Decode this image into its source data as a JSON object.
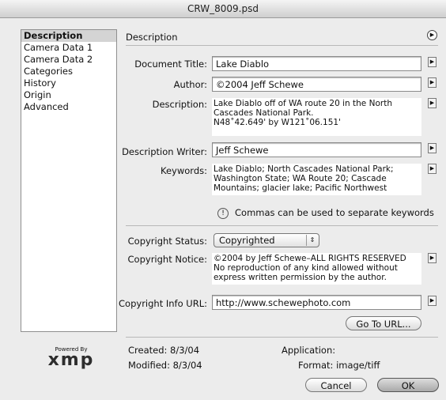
{
  "window": {
    "title": "CRW_8009.psd"
  },
  "sidebar": {
    "items": [
      "Description",
      "Camera Data 1",
      "Camera Data 2",
      "Categories",
      "History",
      "Origin",
      "Advanced"
    ],
    "selected": "Description"
  },
  "panel": {
    "title": "Description"
  },
  "fields": {
    "document_title": {
      "label": "Document Title:",
      "value": "Lake Diablo"
    },
    "author": {
      "label": "Author:",
      "value": "©2004 Jeff Schewe"
    },
    "description": {
      "label": "Description:",
      "lines": [
        "Lake Diablo off of WA route 20 in the North",
        "Cascades National Park.",
        "N48˚42.649' by W121˚06.151'"
      ]
    },
    "description_writer": {
      "label": "Description Writer:",
      "value": "Jeff Schewe"
    },
    "keywords": {
      "label": "Keywords:",
      "lines": [
        "Lake Diablo; North Cascades National Park;",
        "Washington State; WA Route 20; Cascade",
        "Mountains; glacier lake; Pacific Northwest"
      ]
    },
    "keywords_hint": "Commas can be used to separate keywords",
    "copyright_status": {
      "label": "Copyright Status:",
      "value": "Copyrighted"
    },
    "copyright_notice": {
      "label": "Copyright Notice:",
      "lines": [
        "©2004 by Jeff Schewe–ALL RIGHTS RESERVED",
        "No reproduction of any kind allowed without",
        "express written permission by the author."
      ]
    },
    "copyright_url": {
      "label": "Copyright Info URL:",
      "value": "http://www.schewephoto.com"
    }
  },
  "buttons": {
    "go_to_url": "Go To URL...",
    "cancel": "Cancel",
    "ok": "OK"
  },
  "meta": {
    "created_label": "Created:",
    "created": "8/3/04",
    "modified_label": "Modified:",
    "modified": "8/3/04",
    "application_label": "Application:",
    "application": "",
    "format_label": "Format:",
    "format": "image/tiff"
  },
  "logo": {
    "powered_by": "Powered By",
    "name": "xmp"
  }
}
